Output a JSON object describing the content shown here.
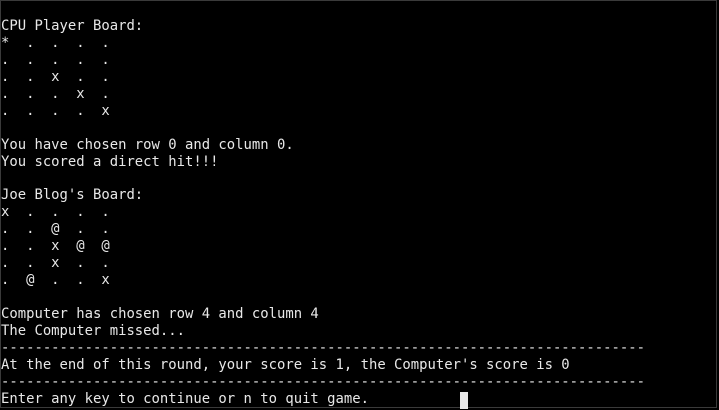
{
  "cpu_board": {
    "title": "CPU Player Board:",
    "rows": [
      "*  .  .  .  .",
      ".  .  .  .  .",
      ".  .  x  .  .",
      ".  .  .  x  .",
      ".  .  .  .  x"
    ]
  },
  "player_turn": {
    "choice": "You have chosen row 0 and column 0.",
    "result": "You scored a direct hit!!!"
  },
  "player_board": {
    "title": "Joe Blog's Board:",
    "rows": [
      "x  .  .  .  .",
      ".  .  @  .  .",
      ".  .  x  @  @",
      ".  .  x  .  .",
      ".  @  .  .  x"
    ]
  },
  "computer_turn": {
    "choice": "Computer has chosen row 4 and column 4",
    "result": "The Computer missed..."
  },
  "round_summary": {
    "divider": "-----------------------------------------------------------------------------",
    "score_line": "At the end of this round, your score is 1, the Computer's score is 0"
  },
  "prompt": {
    "text": "Enter any key to continue or n to quit game."
  }
}
